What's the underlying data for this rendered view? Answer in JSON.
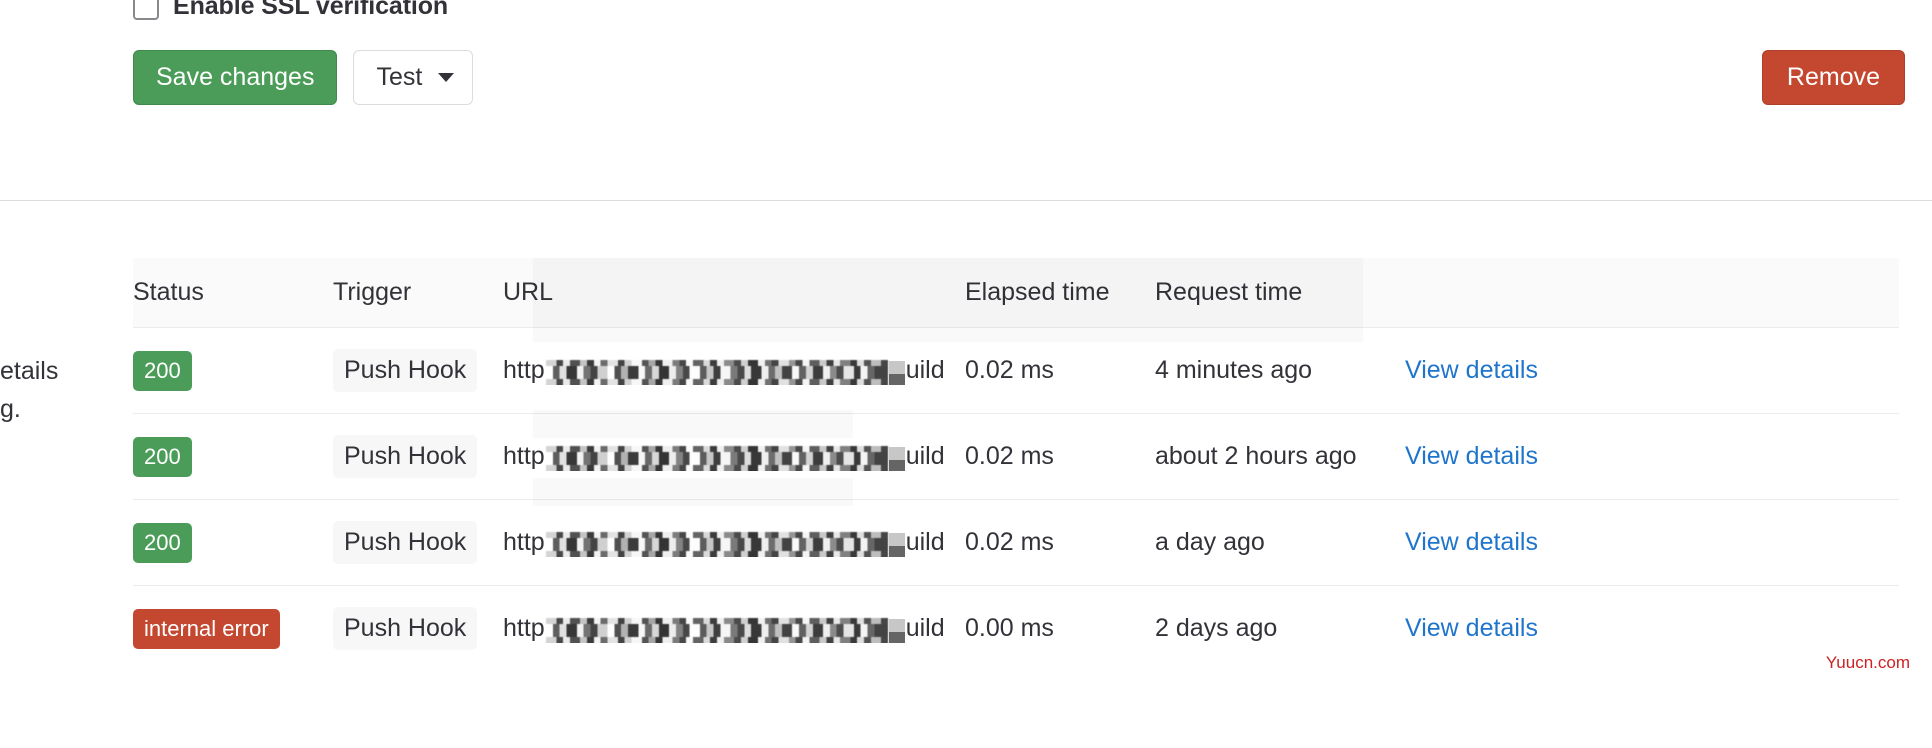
{
  "form": {
    "ssl_checkbox_label": "Enable SSL verification",
    "ssl_checked": false,
    "save_label": "Save changes",
    "test_label": "Test",
    "remove_label": "Remove"
  },
  "side_text": {
    "line1": "etails",
    "line2": "g."
  },
  "table": {
    "headers": {
      "status": "Status",
      "trigger": "Trigger",
      "url": "URL",
      "elapsed": "Elapsed time",
      "request": "Request time",
      "action": ""
    },
    "rows": [
      {
        "status": "200",
        "status_type": "success",
        "trigger": "Push Hook",
        "url_prefix": "http",
        "url_suffix": "uild",
        "elapsed": "0.02 ms",
        "request": "4 minutes ago",
        "action": "View details"
      },
      {
        "status": "200",
        "status_type": "success",
        "trigger": "Push Hook",
        "url_prefix": "http",
        "url_suffix": "uild",
        "elapsed": "0.02 ms",
        "request": "about 2 hours ago",
        "action": "View details"
      },
      {
        "status": "200",
        "status_type": "success",
        "trigger": "Push Hook",
        "url_prefix": "http",
        "url_suffix": "uild",
        "elapsed": "0.02 ms",
        "request": "a day ago",
        "action": "View details"
      },
      {
        "status": "internal error",
        "status_type": "error",
        "trigger": "Push Hook",
        "url_prefix": "http",
        "url_suffix": "uild",
        "elapsed": "0.00 ms",
        "request": "2 days ago",
        "action": "View details"
      }
    ]
  },
  "watermark": "Yuucn.com",
  "colors": {
    "success_green": "#4a9c58",
    "error_red": "#c4472f",
    "link_blue": "#1f75cb",
    "header_bg": "#fafafa",
    "border": "#ececef"
  }
}
